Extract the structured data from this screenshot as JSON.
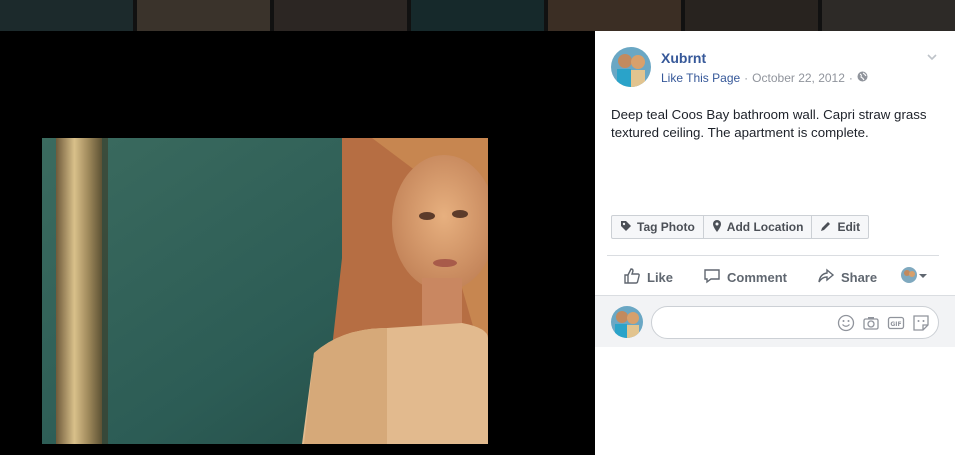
{
  "post": {
    "author": "Xubrnt",
    "like_page": "Like This Page",
    "separator": "·",
    "date": "October 22, 2012",
    "privacy_icon": "globe-icon",
    "caption": "Deep teal Coos Bay bathroom wall. Capri straw grass textured ceiling. The apartment is complete."
  },
  "photo_tools": {
    "tag_photo": "Tag Photo",
    "add_location": "Add Location",
    "edit": "Edit"
  },
  "actions": {
    "like": "Like",
    "comment": "Comment",
    "share": "Share"
  },
  "comment_box": {
    "placeholder": "",
    "icons": [
      "emoji-icon",
      "camera-icon",
      "gif-icon",
      "sticker-icon"
    ]
  },
  "colors": {
    "link": "#365899",
    "photo_wall": "#2f5d55",
    "photo_hair": "#c98b55"
  }
}
